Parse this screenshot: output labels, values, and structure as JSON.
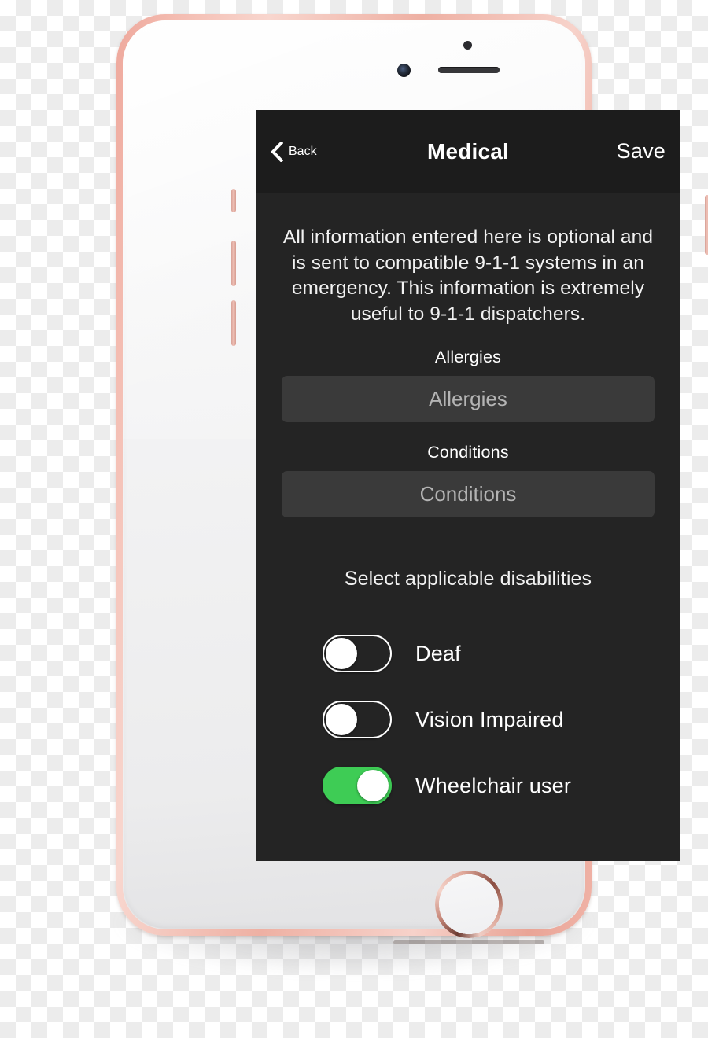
{
  "device": {
    "frame_color": "#eeb0a3",
    "face_color": "#f2f2f3",
    "hardware": {
      "ambient_sensor": "ambient-light-sensor",
      "front_camera": "front-camera",
      "earpiece": "earpiece-speaker",
      "home_button": "home-button",
      "silent_switch": "silent-switch",
      "volume_up": "volume-up-button",
      "volume_down": "volume-down-button",
      "power": "power-button"
    }
  },
  "screen": {
    "background_color": "#242424",
    "nav": {
      "back_label": "Back",
      "title": "Medical",
      "save_label": "Save",
      "background_color": "#1c1c1c"
    },
    "intro_text": "All information entered here is optional and is sent to compatible 9-1-1 systems in an emergency. This information is extremely useful to 9-1-1 dispatchers.",
    "fields": [
      {
        "label": "Allergies",
        "placeholder": "Allergies",
        "value": ""
      },
      {
        "label": "Conditions",
        "placeholder": "Conditions",
        "value": ""
      }
    ],
    "disabilities_heading": "Select applicable disabilities",
    "toggles": [
      {
        "label": "Deaf",
        "state": "off"
      },
      {
        "label": "Vision Impaired",
        "state": "off"
      },
      {
        "label": "Wheelchair user",
        "state": "on"
      }
    ],
    "colors": {
      "toggle_on": "#3ecc55",
      "toggle_off_track": "#242424",
      "toggle_knob": "#ffffff",
      "input_background": "#3a3a3a",
      "placeholder_text": "#b4b4b4",
      "primary_text": "#ffffff"
    }
  }
}
